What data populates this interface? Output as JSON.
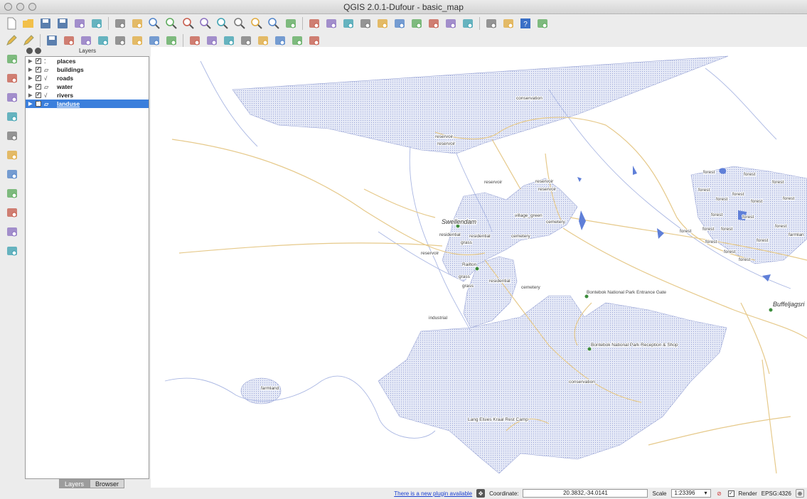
{
  "window": {
    "title": "QGIS 2.0.1-Dufour - basic_map"
  },
  "toolbar1": [
    "new-file-icon",
    "open-folder-icon",
    "save-icon",
    "save-as-icon",
    "new-print-composer-icon",
    "composer-manager-icon",
    "pan-icon",
    "pan-to-selection-icon",
    "zoom-in-icon",
    "zoom-out-icon",
    "zoom-actual-icon",
    "zoom-full-icon",
    "zoom-to-selection-icon",
    "zoom-to-layer-icon",
    "zoom-last-icon",
    "zoom-next-icon",
    "refresh-icon",
    "identify-icon",
    "action-icon",
    "select-icon",
    "deselect-icon",
    "field-calculator-icon",
    "attribute-table-icon",
    "statistics-icon",
    "measure-icon",
    "map-tips-icon",
    "bookmark-icon",
    "new-bookmark-icon",
    "text-annotation-icon",
    "help-icon",
    "whats-this-icon"
  ],
  "toolbar2": [
    "toggle-editing-icon",
    "edit-pencil-icon",
    "save-edits-icon",
    "add-feature-icon",
    "move-feature-icon",
    "node-tool-icon",
    "delete-selected-icon",
    "cut-features-icon",
    "copy-features-icon",
    "paste-features-icon",
    "label-toolbar-icon",
    "pin-labels-icon",
    "show-hide-labels-icon",
    "move-label-icon",
    "rotate-label-icon",
    "change-label-icon",
    "label-props-icon",
    "undo-label-icon"
  ],
  "lefttools": [
    "add-vector-layer-icon",
    "add-raster-layer-icon",
    "add-postgis-layer-icon",
    "add-spatialite-layer-icon",
    "add-mssql-layer-icon",
    "add-wms-layer-icon",
    "add-wcs-layer-icon",
    "add-wfs-layer-icon",
    "add-delimited-text-icon",
    "new-shapefile-icon",
    "remove-layer-icon"
  ],
  "layers_panel": {
    "title": "Layers",
    "layers": [
      {
        "name": "places",
        "icon": "point-layer-icon",
        "checked": true,
        "selected": false
      },
      {
        "name": "buildings",
        "icon": "polygon-layer-icon",
        "checked": true,
        "selected": false
      },
      {
        "name": "roads",
        "icon": "line-layer-icon",
        "checked": true,
        "selected": false
      },
      {
        "name": "water",
        "icon": "polygon-layer-icon",
        "checked": true,
        "selected": false
      },
      {
        "name": "rivers",
        "icon": "line-layer-icon",
        "checked": true,
        "selected": false
      },
      {
        "name": "landuse",
        "icon": "polygon-layer-icon",
        "checked": true,
        "selected": true
      }
    ],
    "tabs": {
      "layers": "Layers",
      "browser": "Browser"
    }
  },
  "map": {
    "colors": {
      "landuse_fill": "#dfe4f5",
      "landuse_stroke": "#9aa5d6",
      "water": "#5f7fd8",
      "roads": "#e6c98a",
      "rivers": "#aab7e3",
      "places": "#3c8c3c"
    },
    "town_labels": {
      "swellendam": "Swellendam",
      "buffeljagsrivier": "Buffeljagsri",
      "railton": "Railton"
    },
    "poi_labels": {
      "entrance_gate": "Bontebok National Park Entrance Gate",
      "reception": "Bontebok National Park Reception & Shop",
      "camp": "Lang Elsies Kraal Rest Camp"
    },
    "landuse_labels": {
      "conservation": "conservation",
      "reservoir": "reservoir",
      "forest": "forest",
      "residential": "residential",
      "grass": "grass",
      "cemetery": "cemetery",
      "village_green": "village_green",
      "industrial": "industrial",
      "farmland": "farmland",
      "farmland_cut": "farmlan"
    }
  },
  "statusbar": {
    "plugin_link": "There is a new plugin available",
    "coordinate_label": "Coordinate:",
    "coordinate_value": "20.3832,-34.0141",
    "scale_label": "Scale",
    "scale_value": "1:23396",
    "render_label": "Render",
    "crs": "EPSG:4326"
  }
}
